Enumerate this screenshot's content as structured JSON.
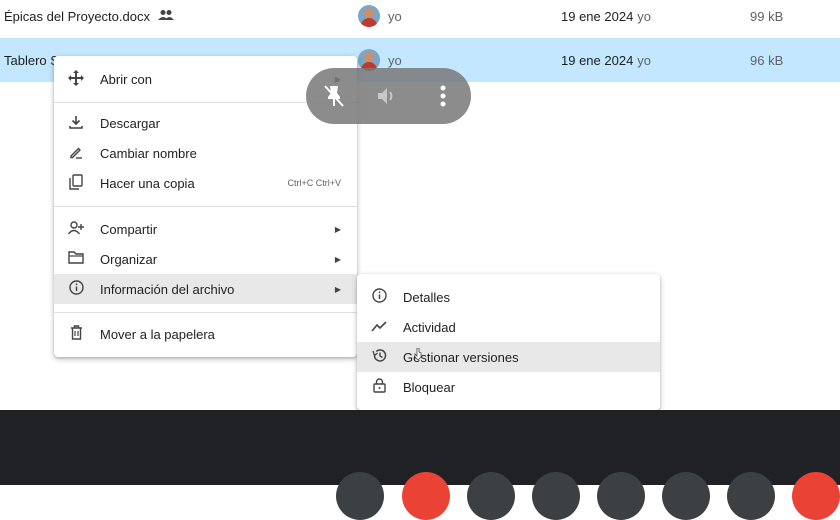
{
  "files": [
    {
      "name": "Épicas del Proyecto.docx",
      "shared_icon": "people-icon",
      "owner": "yo",
      "date": "19 ene 2024",
      "modified_by": "yo",
      "size": "99 kB",
      "selected": false
    },
    {
      "name": "Tablero S",
      "owner": "yo",
      "date": "19 ene 2024",
      "modified_by": "yo",
      "size": "96 kB",
      "selected": true
    }
  ],
  "context_menu": {
    "open_with": "Abrir con",
    "download": "Descargar",
    "rename": "Cambiar nombre",
    "make_copy": "Hacer una copia",
    "make_copy_shortcut": "Ctrl+C Ctrl+V",
    "share": "Compartir",
    "organize": "Organizar",
    "file_info": "Información del archivo",
    "trash": "Mover a la papelera"
  },
  "submenu": {
    "details": "Detalles",
    "activity": "Actividad",
    "manage_versions": "Gestionar versiones",
    "lock": "Bloquear"
  },
  "colors": {
    "selected_row": "#c2e7ff",
    "highlight": "#e8e8e8",
    "bottom_bar": "#202124",
    "record_red": "#ea4335"
  }
}
